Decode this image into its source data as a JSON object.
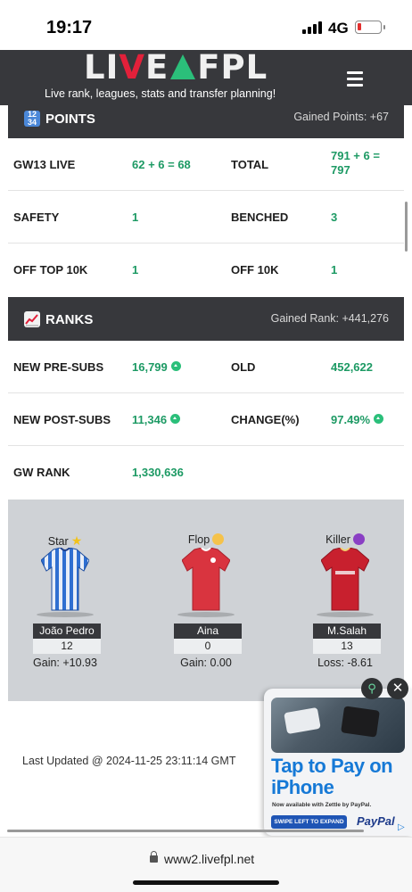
{
  "status_bar": {
    "time": "19:17",
    "network": "4G"
  },
  "header": {
    "logo_left": "LI",
    "logo_v": "V",
    "logo_e": "E",
    "logo_right": "FPL",
    "tagline": "Live rank, leagues, stats and transfer planning!"
  },
  "points": {
    "title": "POINTS",
    "gained": "Gained Points: +67",
    "rows": [
      {
        "label": "GW13 LIVE",
        "value": "62 + 6 = 68",
        "label2": "TOTAL",
        "value2": "791 + 6 = 797"
      },
      {
        "label": "SAFETY",
        "value": "1",
        "label2": "BENCHED",
        "value2": "3"
      },
      {
        "label": "OFF TOP 10K",
        "value": "1",
        "label2": "OFF 10K",
        "value2": "1"
      }
    ]
  },
  "ranks": {
    "title": "RANKS",
    "gained": "Gained Rank: +441,276",
    "rows": [
      {
        "label": "NEW PRE-SUBS",
        "value": "16,799",
        "label2": "OLD",
        "value2": "452,622"
      },
      {
        "label": "NEW POST-SUBS",
        "value": "11,346",
        "label2": "CHANGE(%)",
        "value2": "97.49%"
      },
      {
        "label": "GW RANK",
        "value": "1,330,636"
      }
    ]
  },
  "players": [
    {
      "role": "Star",
      "name": "João Pedro",
      "points": "12",
      "gain": "Gain: +10.93",
      "kit_color": "#2f6fd1",
      "emoji": "star"
    },
    {
      "role": "Flop",
      "name": "Aina",
      "points": "0",
      "gain": "Gain: 0.00",
      "kit_color": "#d9343f",
      "emoji": "disappointed-face"
    },
    {
      "role": "Killer",
      "name": "M.Salah",
      "points": "13",
      "gain": "Loss: -8.61",
      "kit_color": "#c8202e",
      "emoji": "devil-face"
    }
  ],
  "last_updated": "Last Updated @ 2024-11-25 23:11:14 GMT",
  "ad": {
    "headline": "Tap to Pay on iPhone",
    "sub": "Now available with Zettle by PayPal.",
    "cta": "SWIPE LEFT TO EXPAND",
    "brand": "PayPal"
  },
  "browser": {
    "url": "www2.livefpl.net"
  },
  "colors": {
    "accent_green": "#1d9a64",
    "bar_dark": "#37383c",
    "logo_red": "#e2203a"
  }
}
